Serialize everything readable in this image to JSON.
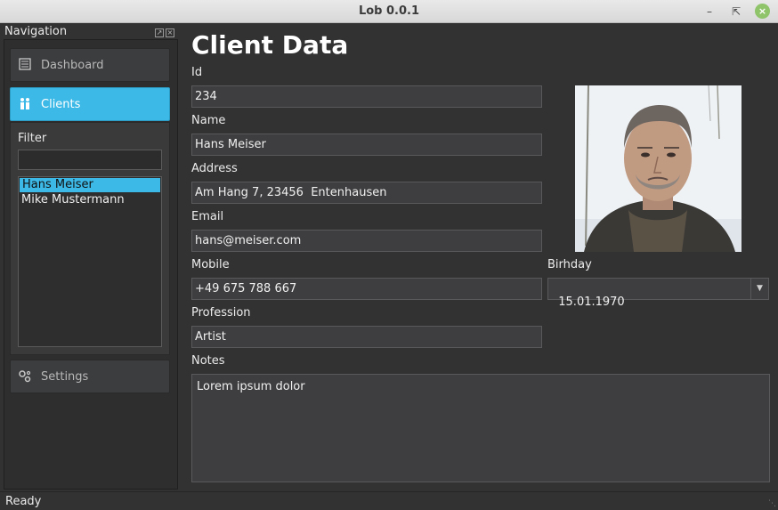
{
  "window": {
    "title": "Lob 0.0.1",
    "min_icon": "minimize-icon",
    "max_icon": "maximize-icon",
    "close_icon": "close-icon"
  },
  "navigation": {
    "title": "Navigation",
    "items": [
      {
        "label": "Dashboard",
        "icon": "dashboard-icon"
      },
      {
        "label": "Clients",
        "icon": "people-icon"
      },
      {
        "label": "Settings",
        "icon": "gears-icon"
      }
    ],
    "filter_label": "Filter",
    "filter_value": "",
    "clients": [
      "Hans Meiser",
      "Mike Mustermann"
    ],
    "selected_client": "Hans Meiser"
  },
  "form": {
    "title": "Client Data",
    "id_label": "Id",
    "id_value": "234",
    "name_label": "Name",
    "name_value": "Hans Meiser",
    "address_label": "Address",
    "address_value": "Am Hang 7, 23456  Entenhausen",
    "email_label": "Email",
    "email_value": "hans@meiser.com",
    "mobile_label": "Mobile",
    "mobile_value": "+49 675 788 667",
    "birthday_label": "Birhday",
    "birthday_value": "15.01.1970",
    "profession_label": "Profession",
    "profession_value": "Artist",
    "notes_label": "Notes",
    "notes_value": "Lorem ipsum dolor"
  },
  "status": {
    "text": "Ready"
  },
  "colors": {
    "accent": "#3cb9e6",
    "background": "#323233",
    "field": "#3e3e40"
  }
}
